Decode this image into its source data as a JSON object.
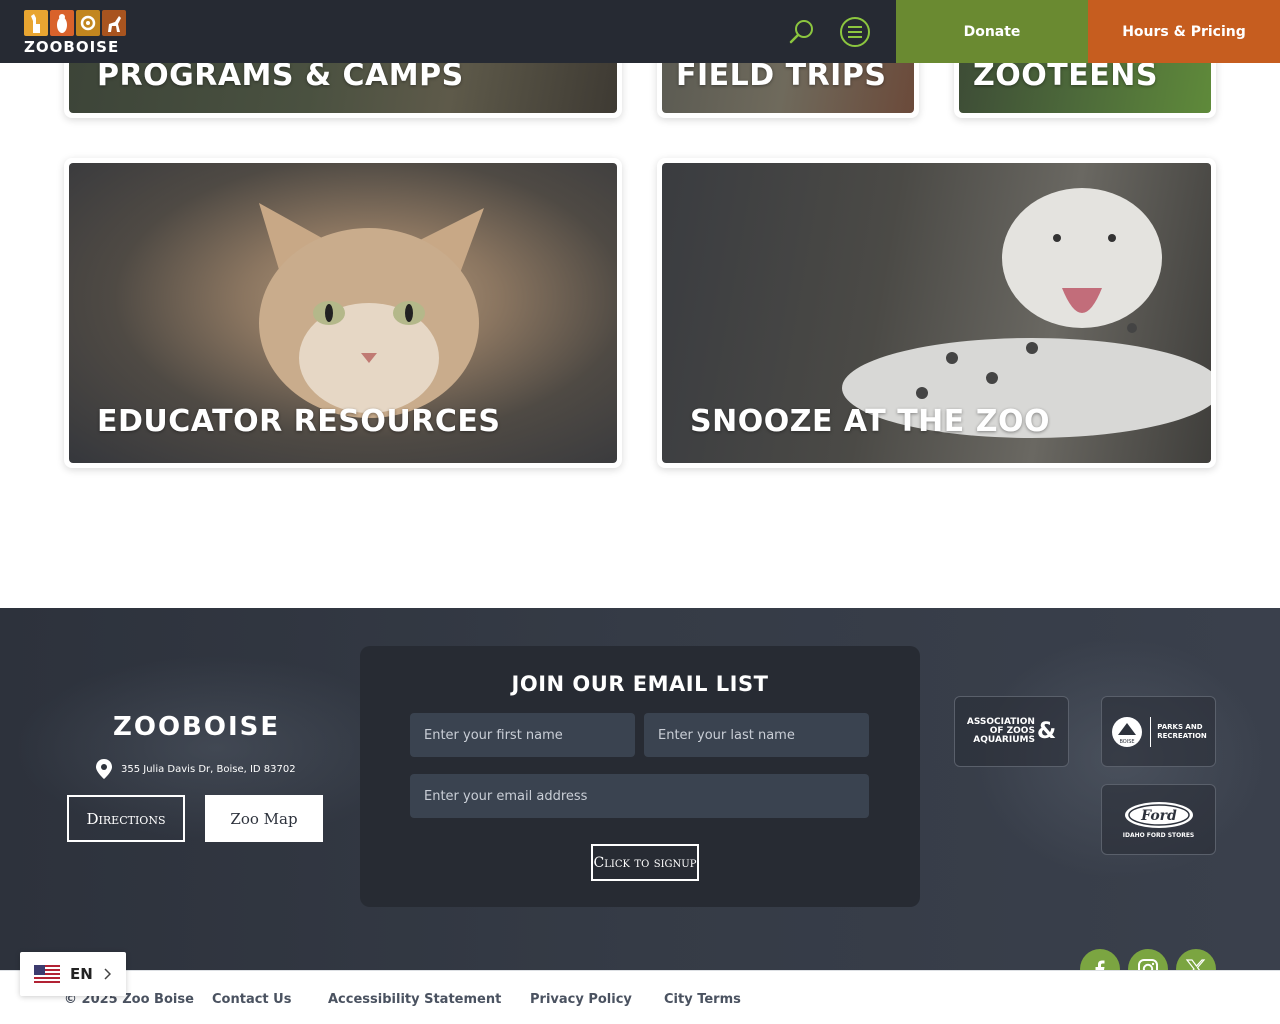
{
  "header": {
    "logo_text": "ZOOBOISE",
    "donate_label": "Donate",
    "hours_label": "Hours & Pricing"
  },
  "cards": [
    {
      "title": "PROGRAMS & CAMPS"
    },
    {
      "title": "FIELD TRIPS"
    },
    {
      "title": "ZOOTEENS"
    },
    {
      "title": "EDUCATOR RESOURCES"
    },
    {
      "title": "SNOOZE AT THE ZOO"
    }
  ],
  "footer": {
    "logo_text": "ZOOBOISE",
    "address": "355 Julia Davis Dr, Boise, ID 83702",
    "directions_label": "Directions",
    "map_label": "Zoo Map",
    "email": {
      "title": "JOIN OUR EMAIL LIST",
      "first_name_placeholder": "Enter your first name",
      "last_name_placeholder": "Enter your last name",
      "email_placeholder": "Enter your email address",
      "signup_label": "Click to signup"
    },
    "partners": {
      "aza_line1": "ASSOCIATION",
      "aza_line2": "OF ZOOS",
      "aza_line3": "AQUARIUMS",
      "aza_amp": "&",
      "parks_line1": "PARKS AND",
      "parks_line2": "RECREATION",
      "parks_seal": "BOISE",
      "ford_logo": "Ford",
      "ford_caption": "IDAHO FORD STORES"
    }
  },
  "bottom": {
    "copyright": "© 2025 Zoo Boise",
    "links": [
      "Contact Us",
      "Accessibility Statement",
      "Privacy Policy",
      "City Terms"
    ]
  },
  "social": [
    "facebook-icon",
    "instagram-icon",
    "x-icon"
  ],
  "language": {
    "code": "EN"
  },
  "colors": {
    "header_bg": "#262a33",
    "donate_green": "#6a8a31",
    "hours_orange": "#c65d1f",
    "social_green": "#7ba541",
    "icon_green": "#8cc63f"
  }
}
